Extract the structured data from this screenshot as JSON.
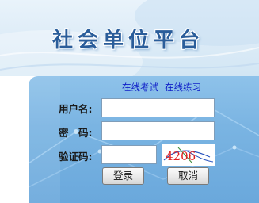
{
  "header": {
    "title": "社会单位平台"
  },
  "links": {
    "online_exam": "在线考试",
    "online_practice": "在线练习"
  },
  "form": {
    "username_label": "用户名:",
    "password_label": "密　码:",
    "captcha_label": "验证码:",
    "username_value": "",
    "password_value": "",
    "captcha_value": "",
    "captcha_image_text": "4206"
  },
  "buttons": {
    "login": "登录",
    "cancel": "取消"
  },
  "colors": {
    "banner_bg": "#dcebf7",
    "panel_bg": "#7ab4e2",
    "link": "#1020c8",
    "captcha_text": "#e02020",
    "title": "#2a5d9a"
  }
}
